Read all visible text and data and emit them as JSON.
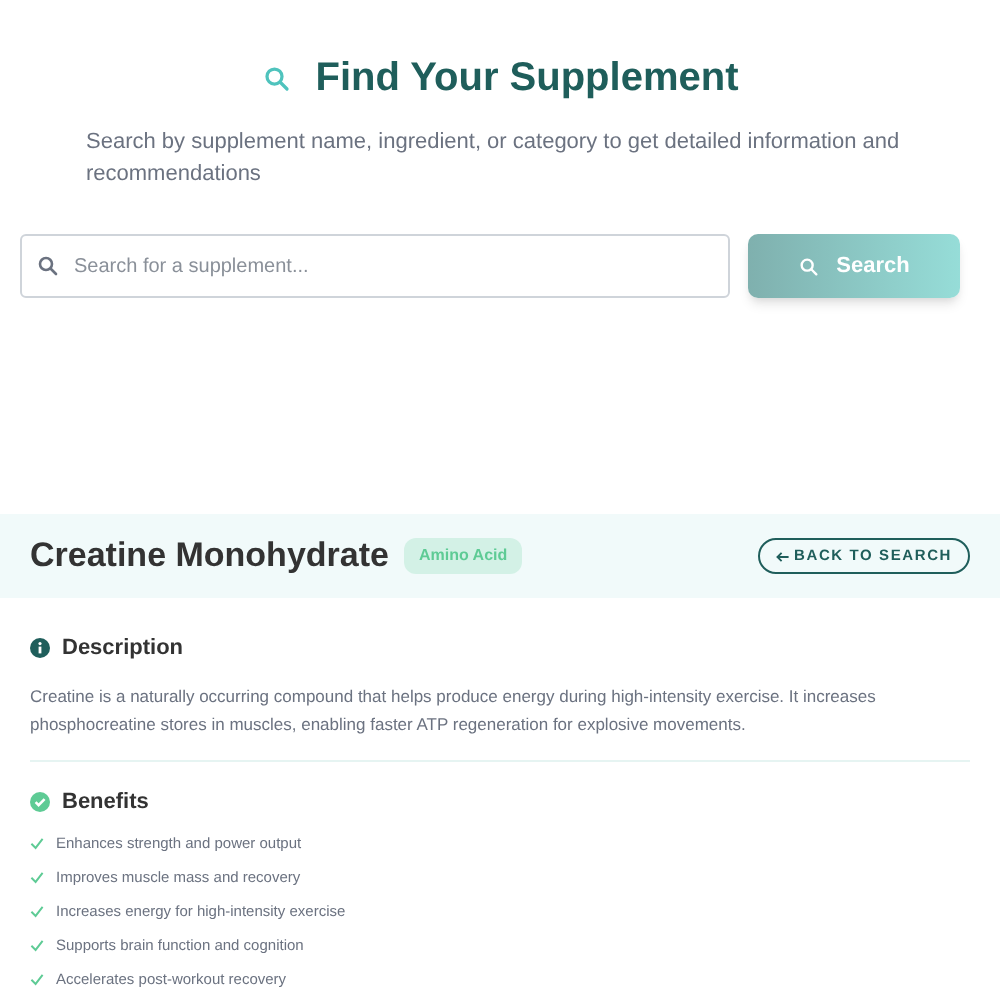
{
  "hero": {
    "title": "Find Your Supplement",
    "subtitle": "Search by supplement name, ingredient, or category to get detailed information and recommendations"
  },
  "search": {
    "placeholder": "Search for a supplement...",
    "button": "Search"
  },
  "detail": {
    "name": "Creatine Monohydrate",
    "category": "Amino Acid",
    "back": "BACK TO SEARCH",
    "description_title": "Description",
    "description": "Creatine is a naturally occurring compound that helps produce energy during high-intensity exercise. It increases phosphocreatine stores in muscles, enabling faster ATP regeneration for explosive movements.",
    "benefits_title": "Benefits",
    "benefits": [
      "Enhances strength and power output",
      "Improves muscle mass and recovery",
      "Increases energy for high-intensity exercise",
      "Supports brain function and cognition",
      "Accelerates post-workout recovery"
    ]
  }
}
